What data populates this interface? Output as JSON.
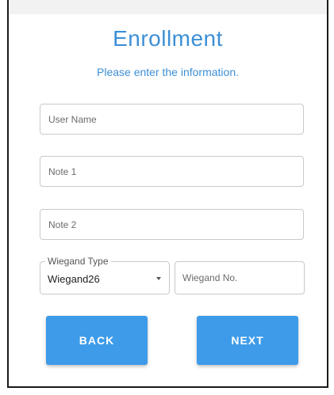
{
  "header": {
    "title": "Enrollment",
    "subtitle": "Please enter the information."
  },
  "form": {
    "user_name": {
      "placeholder": "User Name",
      "value": ""
    },
    "note1": {
      "placeholder": "Note 1",
      "value": ""
    },
    "note2": {
      "placeholder": "Note 2",
      "value": ""
    },
    "wiegand_type": {
      "label": "Wiegand Type",
      "value": "Wiegand26"
    },
    "wiegand_no": {
      "placeholder": "Wiegand No.",
      "value": ""
    }
  },
  "buttons": {
    "back_label": "BACK",
    "next_label": "NEXT"
  },
  "colors": {
    "accent": "#3d8fd6",
    "button": "#3d9be9",
    "field_border": "#c9c9c9"
  }
}
